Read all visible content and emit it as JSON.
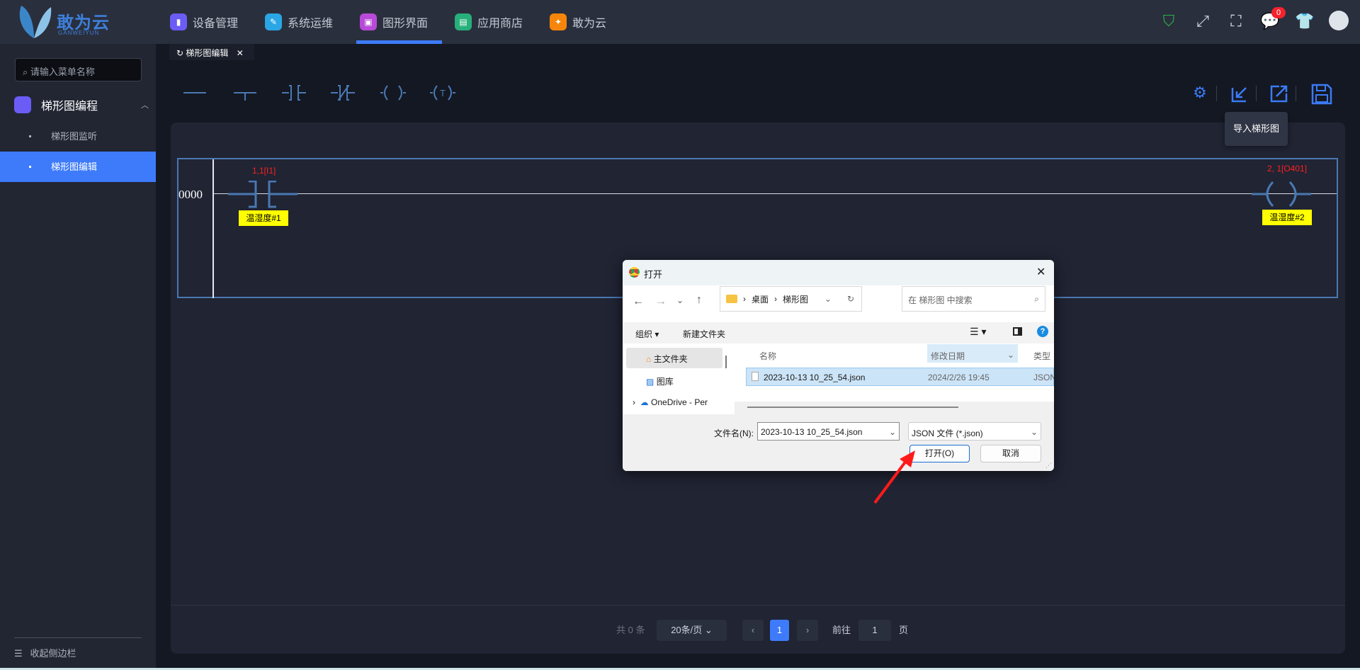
{
  "header": {
    "logo": "敢为云",
    "logo_sub": "GANWEIYUN",
    "nav": [
      {
        "label": "设备管理",
        "color": "#6b5cf6"
      },
      {
        "label": "系统运维",
        "color": "#2aa6e6"
      },
      {
        "label": "图形界面",
        "color": "#b84ad8"
      },
      {
        "label": "应用商店",
        "color": "#27b07a"
      },
      {
        "label": "敢为云",
        "color": "#f5860b"
      }
    ],
    "notifications": "0"
  },
  "sidebar": {
    "search_placeholder": "请输入菜单名称",
    "group": "梯形图编程",
    "items": [
      "梯形图监听",
      "梯形图编辑"
    ],
    "collapse": "收起侧边栏"
  },
  "tab": {
    "label": "梯形图编辑"
  },
  "tooltip": "导入梯形图",
  "ladder": {
    "rung_number": "0000",
    "contact_addr": "1,1[I1]",
    "contact_label": "温湿度#1",
    "coil_addr": "2, 1[O401]",
    "coil_label": "温湿度#2"
  },
  "pagination": {
    "total": "共 0 条",
    "page_size": "20条/页",
    "current": "1",
    "goto_label": "前往",
    "goto_value": "1",
    "page_suffix": "页"
  },
  "dialog": {
    "title": "打开",
    "path": [
      "桌面",
      "梯形图"
    ],
    "search_placeholder": "在 梯形图 中搜索",
    "organize": "组织",
    "new_folder": "新建文件夹",
    "nav": [
      "主文件夹",
      "图库",
      "OneDrive - Per"
    ],
    "columns": [
      "名称",
      "修改日期",
      "类型"
    ],
    "files": [
      {
        "name": "2023-10-13 10_25_54.json",
        "date": "2024/2/26 19:45",
        "type": "JSON"
      }
    ],
    "filename_label": "文件名(N):",
    "filename": "2023-10-13 10_25_54.json",
    "filter": "JSON 文件 (*.json)",
    "open": "打开(O)",
    "cancel": "取消"
  }
}
